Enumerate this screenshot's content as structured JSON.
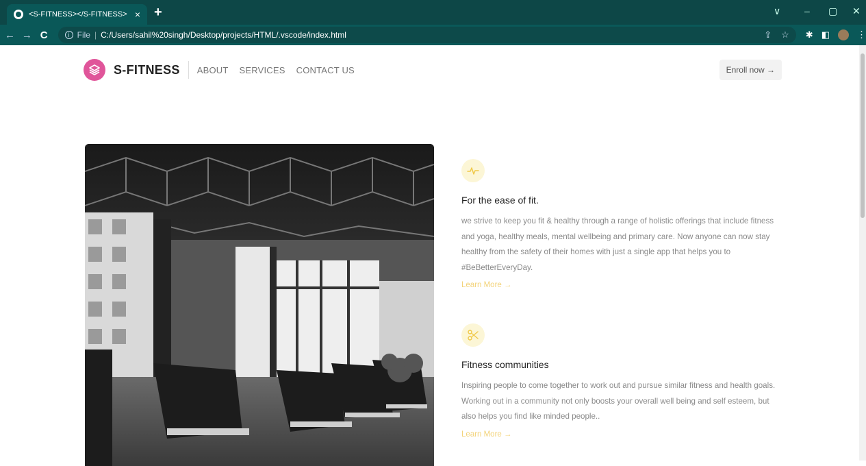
{
  "browser": {
    "tab_title": "<S-FITNESS></S-FITNESS>",
    "tab_close": "×",
    "new_tab": "+",
    "url_scheme": "File",
    "url_sep": "|",
    "url": "C:/Users/sahil%20singh/Desktop/projects/HTML/.vscode/index.html",
    "window_controls": [
      "∨",
      "–",
      "▢",
      "✕"
    ]
  },
  "header": {
    "brand": "S-FITNESS",
    "nav": [
      "ABOUT",
      "SERVICES",
      "CONTACT US"
    ],
    "enroll_label": "Enroll now →"
  },
  "features": [
    {
      "icon": "pulse-icon",
      "title": "For the ease of fit.",
      "description": "we strive to keep you fit & healthy through a range of holistic offerings that include fitness and yoga, healthy meals, mental wellbeing and primary care. Now anyone can now stay healthy from the safety of their homes with just a single app that helps you to #BeBetterEveryDay.",
      "link": "Learn More →"
    },
    {
      "icon": "scissors-icon",
      "title": "Fitness communities",
      "description": "Inspiring people to come together to work out and pursue similar fitness and health goals. Working out in a community not only boosts your overall well being and self esteem, but also helps you find like minded people..",
      "link": "Learn More →"
    }
  ],
  "colors": {
    "browser_frame": "#0d4747",
    "logo": "#e0559a",
    "accent": "#f3d37a"
  }
}
